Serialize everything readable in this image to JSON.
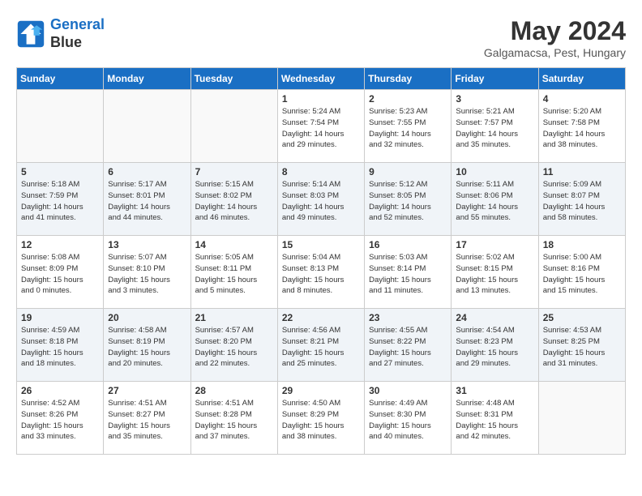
{
  "header": {
    "logo_line1": "General",
    "logo_line2": "Blue",
    "month": "May 2024",
    "location": "Galgamacsa, Pest, Hungary"
  },
  "weekdays": [
    "Sunday",
    "Monday",
    "Tuesday",
    "Wednesday",
    "Thursday",
    "Friday",
    "Saturday"
  ],
  "weeks": [
    [
      {
        "day": "",
        "info": ""
      },
      {
        "day": "",
        "info": ""
      },
      {
        "day": "",
        "info": ""
      },
      {
        "day": "1",
        "info": "Sunrise: 5:24 AM\nSunset: 7:54 PM\nDaylight: 14 hours\nand 29 minutes."
      },
      {
        "day": "2",
        "info": "Sunrise: 5:23 AM\nSunset: 7:55 PM\nDaylight: 14 hours\nand 32 minutes."
      },
      {
        "day": "3",
        "info": "Sunrise: 5:21 AM\nSunset: 7:57 PM\nDaylight: 14 hours\nand 35 minutes."
      },
      {
        "day": "4",
        "info": "Sunrise: 5:20 AM\nSunset: 7:58 PM\nDaylight: 14 hours\nand 38 minutes."
      }
    ],
    [
      {
        "day": "5",
        "info": "Sunrise: 5:18 AM\nSunset: 7:59 PM\nDaylight: 14 hours\nand 41 minutes."
      },
      {
        "day": "6",
        "info": "Sunrise: 5:17 AM\nSunset: 8:01 PM\nDaylight: 14 hours\nand 44 minutes."
      },
      {
        "day": "7",
        "info": "Sunrise: 5:15 AM\nSunset: 8:02 PM\nDaylight: 14 hours\nand 46 minutes."
      },
      {
        "day": "8",
        "info": "Sunrise: 5:14 AM\nSunset: 8:03 PM\nDaylight: 14 hours\nand 49 minutes."
      },
      {
        "day": "9",
        "info": "Sunrise: 5:12 AM\nSunset: 8:05 PM\nDaylight: 14 hours\nand 52 minutes."
      },
      {
        "day": "10",
        "info": "Sunrise: 5:11 AM\nSunset: 8:06 PM\nDaylight: 14 hours\nand 55 minutes."
      },
      {
        "day": "11",
        "info": "Sunrise: 5:09 AM\nSunset: 8:07 PM\nDaylight: 14 hours\nand 58 minutes."
      }
    ],
    [
      {
        "day": "12",
        "info": "Sunrise: 5:08 AM\nSunset: 8:09 PM\nDaylight: 15 hours\nand 0 minutes."
      },
      {
        "day": "13",
        "info": "Sunrise: 5:07 AM\nSunset: 8:10 PM\nDaylight: 15 hours\nand 3 minutes."
      },
      {
        "day": "14",
        "info": "Sunrise: 5:05 AM\nSunset: 8:11 PM\nDaylight: 15 hours\nand 5 minutes."
      },
      {
        "day": "15",
        "info": "Sunrise: 5:04 AM\nSunset: 8:13 PM\nDaylight: 15 hours\nand 8 minutes."
      },
      {
        "day": "16",
        "info": "Sunrise: 5:03 AM\nSunset: 8:14 PM\nDaylight: 15 hours\nand 11 minutes."
      },
      {
        "day": "17",
        "info": "Sunrise: 5:02 AM\nSunset: 8:15 PM\nDaylight: 15 hours\nand 13 minutes."
      },
      {
        "day": "18",
        "info": "Sunrise: 5:00 AM\nSunset: 8:16 PM\nDaylight: 15 hours\nand 15 minutes."
      }
    ],
    [
      {
        "day": "19",
        "info": "Sunrise: 4:59 AM\nSunset: 8:18 PM\nDaylight: 15 hours\nand 18 minutes."
      },
      {
        "day": "20",
        "info": "Sunrise: 4:58 AM\nSunset: 8:19 PM\nDaylight: 15 hours\nand 20 minutes."
      },
      {
        "day": "21",
        "info": "Sunrise: 4:57 AM\nSunset: 8:20 PM\nDaylight: 15 hours\nand 22 minutes."
      },
      {
        "day": "22",
        "info": "Sunrise: 4:56 AM\nSunset: 8:21 PM\nDaylight: 15 hours\nand 25 minutes."
      },
      {
        "day": "23",
        "info": "Sunrise: 4:55 AM\nSunset: 8:22 PM\nDaylight: 15 hours\nand 27 minutes."
      },
      {
        "day": "24",
        "info": "Sunrise: 4:54 AM\nSunset: 8:23 PM\nDaylight: 15 hours\nand 29 minutes."
      },
      {
        "day": "25",
        "info": "Sunrise: 4:53 AM\nSunset: 8:25 PM\nDaylight: 15 hours\nand 31 minutes."
      }
    ],
    [
      {
        "day": "26",
        "info": "Sunrise: 4:52 AM\nSunset: 8:26 PM\nDaylight: 15 hours\nand 33 minutes."
      },
      {
        "day": "27",
        "info": "Sunrise: 4:51 AM\nSunset: 8:27 PM\nDaylight: 15 hours\nand 35 minutes."
      },
      {
        "day": "28",
        "info": "Sunrise: 4:51 AM\nSunset: 8:28 PM\nDaylight: 15 hours\nand 37 minutes."
      },
      {
        "day": "29",
        "info": "Sunrise: 4:50 AM\nSunset: 8:29 PM\nDaylight: 15 hours\nand 38 minutes."
      },
      {
        "day": "30",
        "info": "Sunrise: 4:49 AM\nSunset: 8:30 PM\nDaylight: 15 hours\nand 40 minutes."
      },
      {
        "day": "31",
        "info": "Sunrise: 4:48 AM\nSunset: 8:31 PM\nDaylight: 15 hours\nand 42 minutes."
      },
      {
        "day": "",
        "info": ""
      }
    ]
  ]
}
